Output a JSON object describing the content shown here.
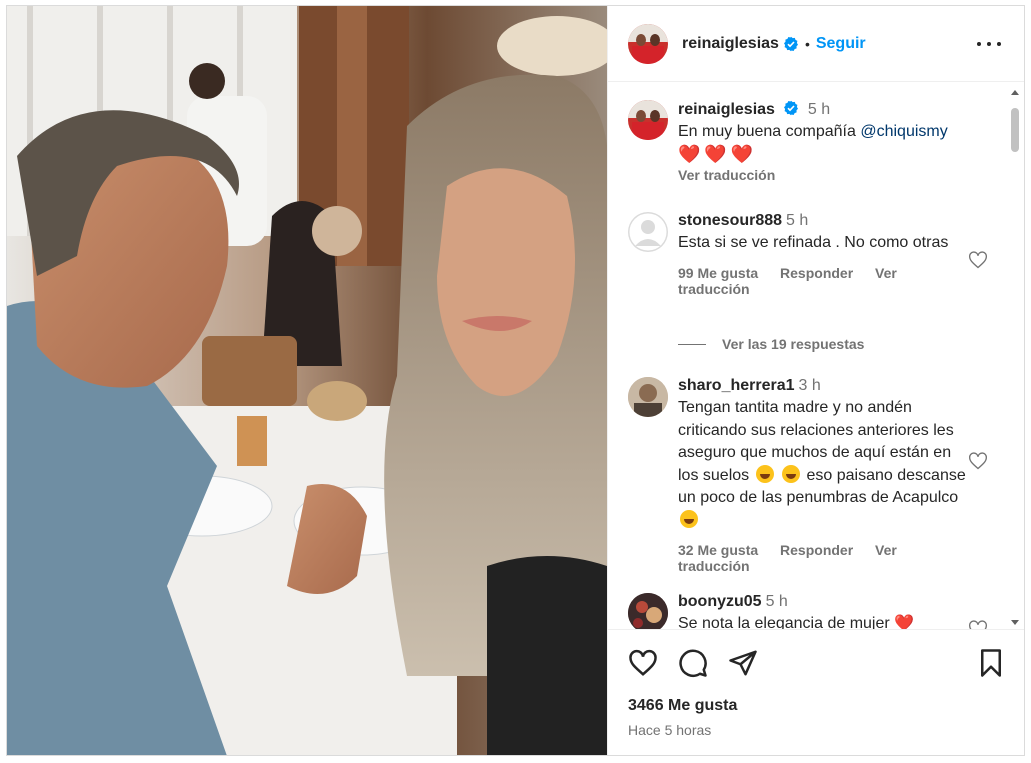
{
  "header": {
    "username": "reinaiglesias",
    "follow_label": "Seguir",
    "separator": "•"
  },
  "caption": {
    "username": "reinaiglesias",
    "time": "5 h",
    "text": "En muy buena compañía ",
    "mention": "@chiquismy",
    "hearts": "❤️❤️❤️",
    "translate": "Ver traducción"
  },
  "comments": [
    {
      "username": "stonesour888",
      "time": "5 h",
      "text": "Esta si se ve refinada . No como otras",
      "likes": "99 Me gusta",
      "reply": "Responder",
      "translate": "Ver traducción"
    },
    {
      "username": "sharo_herrera1",
      "time": "3 h",
      "text_1": "Tengan tantita madre y no andén criticando sus relaciones anteriores les aseguro que muchos de aquí están en los suelos",
      "text_2": " eso paisano descanse un poco de las penumbras de Acapulco",
      "likes": "32 Me gusta",
      "reply": "Responder",
      "translate": "Ver traducción"
    },
    {
      "username": "boonyzu05",
      "time": "5 h",
      "text": "Se nota la elegancia de mujer",
      "heart": "❤️"
    }
  ],
  "replies_label": "Ver las 19 respuestas",
  "footer": {
    "likes": "3466 Me gusta",
    "time_ago": "Hace 5 horas"
  },
  "colors": {
    "link_blue": "#0095f6",
    "secondary_text": "#737373",
    "heart_red": "#e0152b"
  }
}
